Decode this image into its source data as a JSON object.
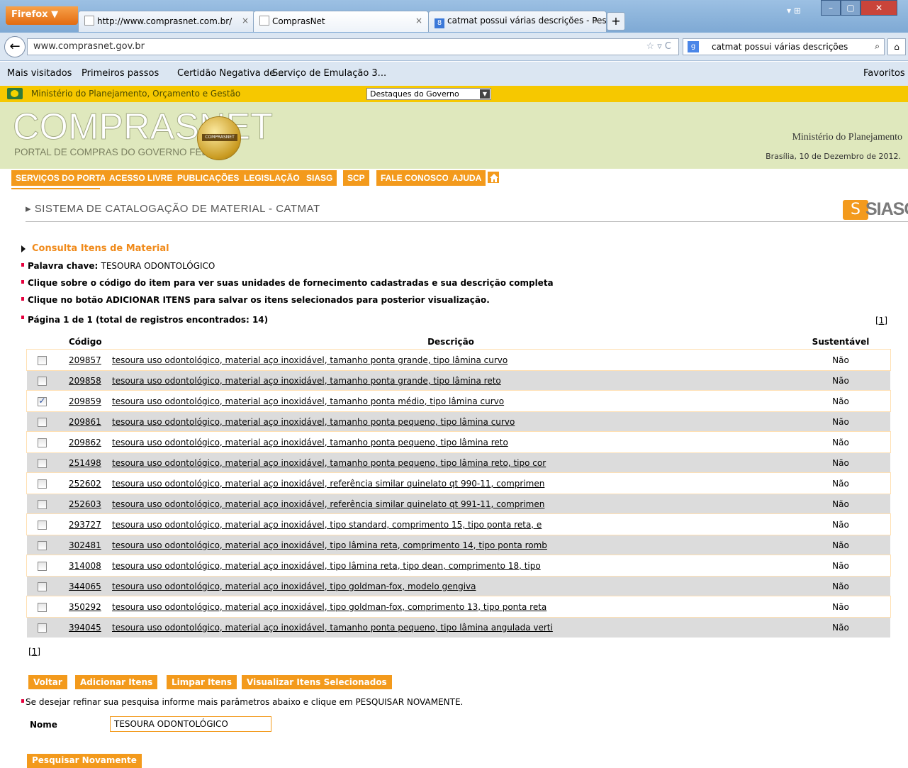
{
  "browser": {
    "app_button": "Firefox ▼",
    "tabs": [
      {
        "label": "http://www.comprasnet.com.br/"
      },
      {
        "label": "ComprasNet"
      },
      {
        "label": "catmat possui várias descrições - Pes..."
      }
    ],
    "url": "www.comprasnet.gov.br",
    "search_value": "catmat possui várias descrições",
    "bookmarks": [
      "Mais visitados",
      "Primeiros passos",
      "Certidão Negativa de ...",
      "Serviço de Emulação 3...",
      "Favoritos"
    ]
  },
  "gov": {
    "ministry": "Ministério do Planejamento, Orçamento e Gestão",
    "select_value": "Destaques do Governo"
  },
  "header": {
    "logo": "COMPRASNET",
    "subtitle": "PORTAL DE COMPRAS DO GOVERNO FEDERAL",
    "seal_text": "COMPRASNET",
    "ministry": "Ministério do Planejamento",
    "date": "Brasília, 10 de Dezembro de 2012."
  },
  "menu": [
    "SERVIÇOS DO PORTAL",
    "ACESSO LIVRE",
    "PUBLICAÇÕES",
    "LEGISLAÇÃO",
    "SIASG",
    "SCP",
    "FALE CONOSCO",
    "AJUDA"
  ],
  "page": {
    "system_title": "SISTEMA DE CATALOGAÇÃO DE MATERIAL - CATMAT",
    "siasg_logo": "SIASG",
    "section_title": "Consulta Itens de Material",
    "keyword_label": "Palavra chave:",
    "keyword_value": "TESOURA ODONTOLÓGICO",
    "hint1": "Clique sobre o código do item para ver suas unidades de fornecimento cadastradas e sua descrição completa",
    "hint2": "Clique no botão ADICIONAR ITENS para salvar os itens selecionados para posterior visualização.",
    "page_info": "Página 1 de 1 (total de registros encontrados: 14)",
    "page_link": "[1]"
  },
  "table": {
    "headers": [
      "Código",
      "Descrição",
      "Sustentável"
    ],
    "rows": [
      {
        "code": "209857",
        "desc": "tesoura uso odontológico, material aço inoxidável, tamanho ponta grande, tipo lâmina curvo",
        "sust": "Não",
        "checked": false
      },
      {
        "code": "209858",
        "desc": "tesoura uso odontológico, material aço inoxidável, tamanho ponta grande, tipo lâmina reto",
        "sust": "Não",
        "checked": false
      },
      {
        "code": "209859",
        "desc": "tesoura uso odontológico, material aço inoxidável, tamanho ponta médio, tipo lâmina curvo",
        "sust": "Não",
        "checked": true
      },
      {
        "code": "209861",
        "desc": "tesoura uso odontológico, material aço inoxidável, tamanho ponta pequeno, tipo lâmina curvo",
        "sust": "Não",
        "checked": false
      },
      {
        "code": "209862",
        "desc": "tesoura uso odontológico, material aço inoxidável, tamanho ponta pequeno, tipo lâmina reto",
        "sust": "Não",
        "checked": false
      },
      {
        "code": "251498",
        "desc": "tesoura uso odontológico, material aço inoxidável, tamanho ponta pequeno, tipo lâmina reto, tipo cor",
        "sust": "Não",
        "checked": false
      },
      {
        "code": "252602",
        "desc": "tesoura uso odontológico, material aço inoxidável, referência similar quinelato qt 990-11, comprimen",
        "sust": "Não",
        "checked": false
      },
      {
        "code": "252603",
        "desc": "tesoura uso odontológico, material aço inoxidável, referência similar quinelato qt 991-11, comprimen",
        "sust": "Não",
        "checked": false
      },
      {
        "code": "293727",
        "desc": "tesoura uso odontológico, material aço inoxidável, tipo standard, comprimento 15, tipo ponta reta, e",
        "sust": "Não",
        "checked": false
      },
      {
        "code": "302481",
        "desc": "tesoura uso odontológico, material aço inoxidável, tipo lâmina reta, comprimento 14, tipo ponta romb",
        "sust": "Não",
        "checked": false
      },
      {
        "code": "314008",
        "desc": "tesoura uso odontológico, material aço inoxidável, tipo lâmina reta, tipo dean, comprimento 18, tipo",
        "sust": "Não",
        "checked": false
      },
      {
        "code": "344065",
        "desc": "tesoura uso odontológico, material aço inoxidável, tipo goldman-fox, modelo gengiva",
        "sust": "Não",
        "checked": false
      },
      {
        "code": "350292",
        "desc": "tesoura uso odontológico, material aço inoxidável, tipo goldman-fox, comprimento 13, tipo ponta reta",
        "sust": "Não",
        "checked": false
      },
      {
        "code": "394045",
        "desc": "tesoura uso odontológico, material aço inoxidável, tamanho ponta pequeno, tipo lâmina angulada verti",
        "sust": "Não",
        "checked": false
      }
    ]
  },
  "buttons": {
    "voltar": "Voltar",
    "adicionar": "Adicionar Itens",
    "limpar": "Limpar Itens",
    "visualizar": "Visualizar Itens Selecionados",
    "pesquisar": "Pesquisar Novamente"
  },
  "refine": {
    "text": "Se desejar refinar sua pesquisa informe mais parâmetros abaixo e clique em PESQUISAR NOVAMENTE.",
    "nome_label": "Nome",
    "nome_value": "TESOURA ODONTOLÓGICO"
  },
  "colors": {
    "accent": "#f39a1c",
    "gov_bar": "#f6c800",
    "header_bg": "#dfe8bd",
    "row_alt": "#dcdcdc"
  }
}
